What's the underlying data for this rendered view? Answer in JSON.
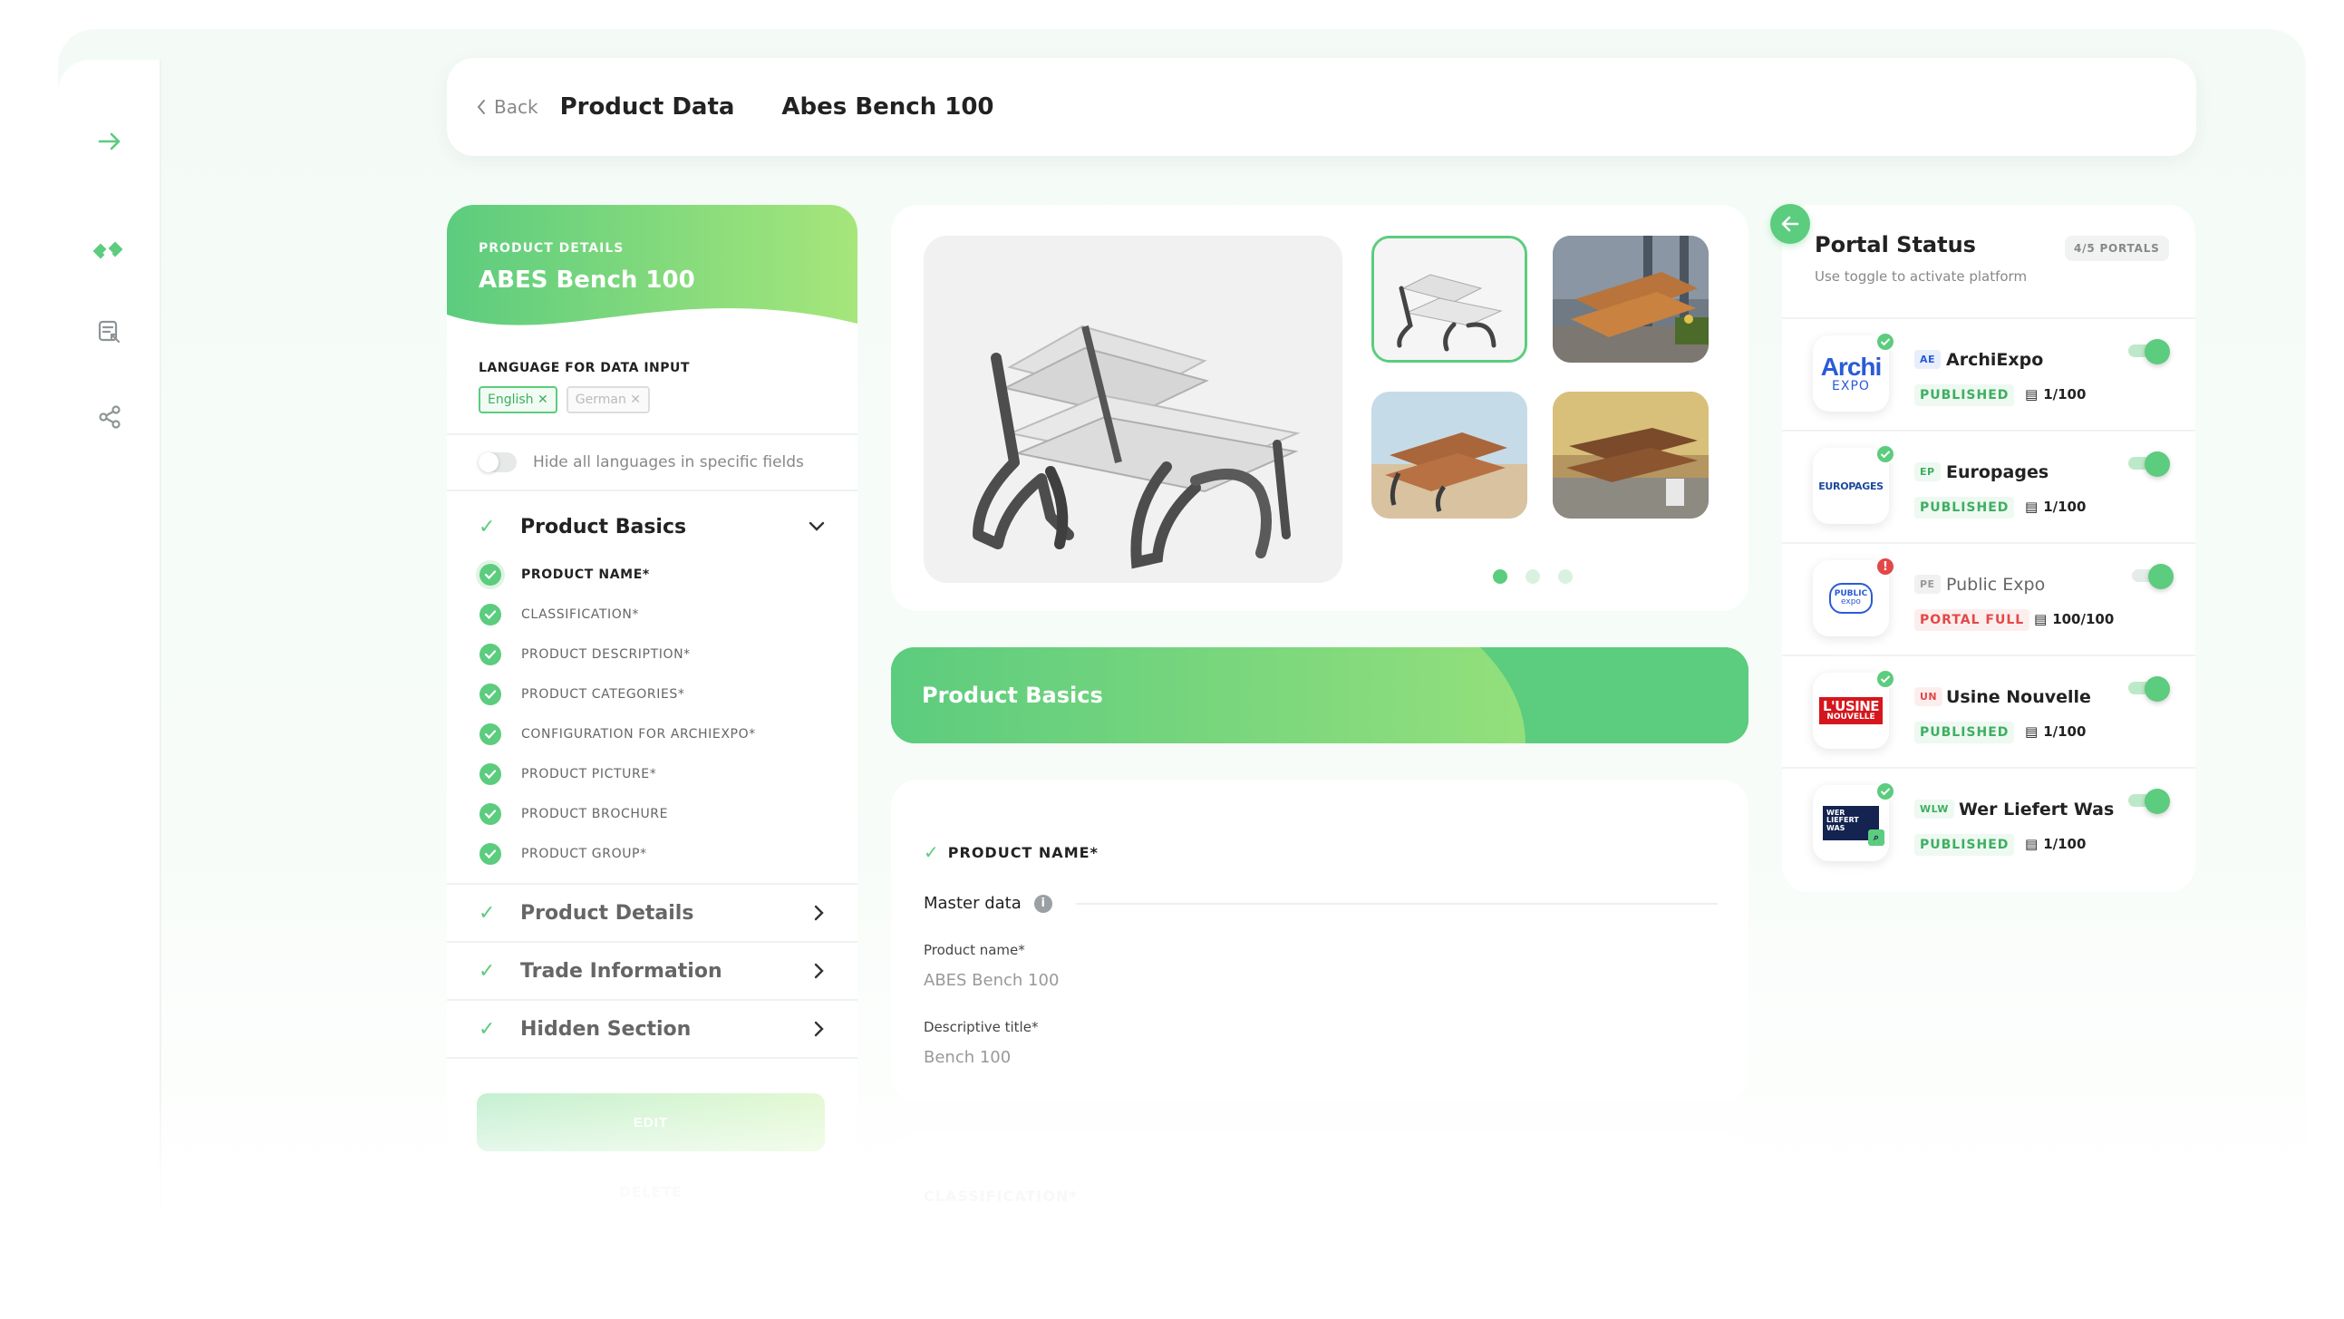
{
  "header": {
    "back_label": "Back",
    "title": "Product Data",
    "product": "Abes Bench 100"
  },
  "left": {
    "eyebrow": "PRODUCT DETAILS",
    "product_name": "ABES Bench 100",
    "language_label": "LANGUAGE FOR DATA INPUT",
    "languages": [
      "English",
      "German"
    ],
    "hide_languages_label": "Hide all languages in specific fields",
    "sections": [
      {
        "title": "Product Basics"
      },
      {
        "title": "Product Details"
      },
      {
        "title": "Trade Information"
      },
      {
        "title": "Hidden Section"
      }
    ],
    "basics_items": [
      "PRODUCT NAME*",
      "CLASSIFICATION*",
      "PRODUCT DESCRIPTION*",
      "PRODUCT CATEGORIES*",
      "CONFIGURATION FOR ARCHIEXPO*",
      "PRODUCT PICTURE*",
      "PRODUCT BROCHURE",
      "PRODUCT GROUP*"
    ],
    "edit_label": "EDIT",
    "delete_label": "DELETE"
  },
  "center": {
    "banner_title": "Product Basics",
    "field_heading": "PRODUCT NAME*",
    "master_data_label": "Master data",
    "info_glyph": "i",
    "fields": [
      {
        "label": "Product name*",
        "value": "ABES Bench 100"
      },
      {
        "label": "Descriptive title*",
        "value": "Bench 100"
      }
    ],
    "next_heading": "CLASSIFICATION*"
  },
  "portal_status": {
    "title": "Portal Status",
    "subtitle": "Use toggle to activate platform",
    "badge": "4/5 PORTALS",
    "portals": [
      {
        "abbr": "AE",
        "name": "ArchiExpo",
        "state": "PUBLISHED",
        "count": "1/100",
        "enabled": true,
        "logo_text": "Archi",
        "logo_sub": "EXPO"
      },
      {
        "abbr": "EP",
        "name": "Europages",
        "state": "PUBLISHED",
        "count": "1/100",
        "enabled": true,
        "logo_text": "EUROPAGES"
      },
      {
        "abbr": "PE",
        "name": "Public Expo",
        "state": "PORTAL FULL",
        "count": "100/100",
        "enabled": false,
        "logo_text": "PUBLIC",
        "logo_sub": "expo"
      },
      {
        "abbr": "UN",
        "name": "Usine Nouvelle",
        "state": "PUBLISHED",
        "count": "1/100",
        "enabled": true,
        "logo_text": "L'USINE",
        "logo_sub": "NOUVELLE"
      },
      {
        "abbr": "WLW",
        "name": "Wer Liefert Was",
        "state": "PUBLISHED",
        "count": "1/100",
        "enabled": true,
        "logo_text": "WER LIEFERT WAS"
      }
    ],
    "alert_glyph": "!"
  },
  "colors": {
    "accent": "#5ccc7e",
    "accent_light": "#a6e67b",
    "danger": "#e34848"
  }
}
